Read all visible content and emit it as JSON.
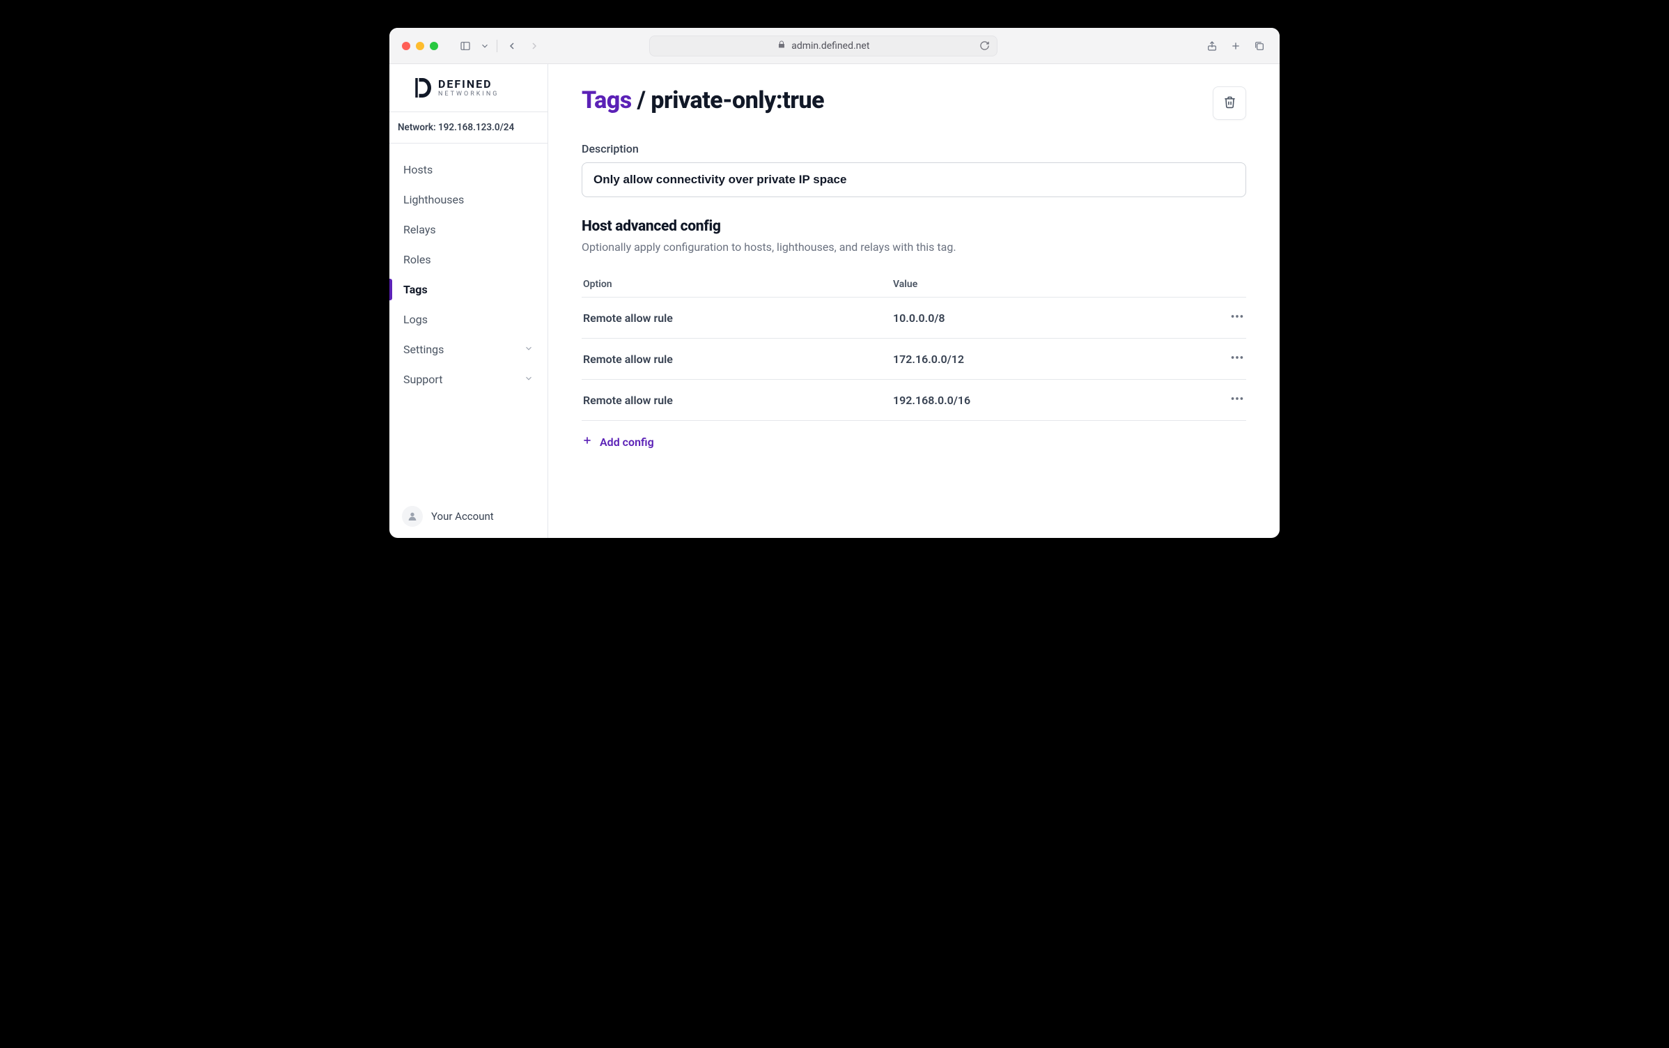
{
  "browser": {
    "url": "admin.defined.net"
  },
  "logo": {
    "line1": "DEFINED",
    "line2": "NETWORKING"
  },
  "sidebar": {
    "network_label": "Network: 192.168.123.0/24",
    "items": [
      {
        "label": "Hosts",
        "expandable": false
      },
      {
        "label": "Lighthouses",
        "expandable": false
      },
      {
        "label": "Relays",
        "expandable": false
      },
      {
        "label": "Roles",
        "expandable": false
      },
      {
        "label": "Tags",
        "expandable": false
      },
      {
        "label": "Logs",
        "expandable": false
      },
      {
        "label": "Settings",
        "expandable": true
      },
      {
        "label": "Support",
        "expandable": true
      }
    ],
    "account_label": "Your Account"
  },
  "page": {
    "breadcrumb_root": "Tags",
    "breadcrumb_sep": " / ",
    "breadcrumb_current": "private-only:true",
    "description_label": "Description",
    "description_value": "Only allow connectivity over private IP space",
    "advanced_heading": "Host advanced config",
    "advanced_subtext": "Optionally apply configuration to hosts, lighthouses, and relays with this tag.",
    "table": {
      "col_option": "Option",
      "col_value": "Value",
      "rows": [
        {
          "option": "Remote allow rule",
          "value": "10.0.0.0/8"
        },
        {
          "option": "Remote allow rule",
          "value": "172.16.0.0/12"
        },
        {
          "option": "Remote allow rule",
          "value": "192.168.0.0/16"
        }
      ]
    },
    "add_config_label": "Add config"
  }
}
